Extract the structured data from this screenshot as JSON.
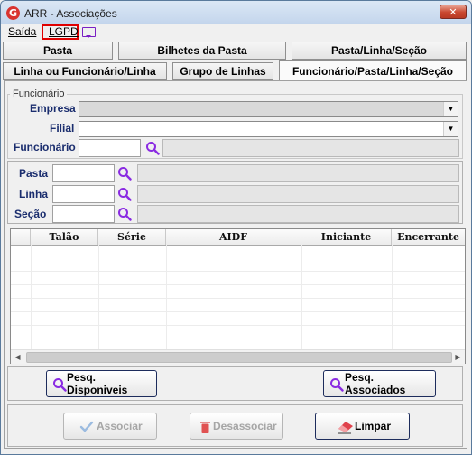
{
  "window": {
    "title": "ARR - Associações",
    "close_glyph": "✕",
    "app_icon": "G"
  },
  "menu": {
    "saida": "Saída",
    "lgpd": "LGPD"
  },
  "tabs_row1": [
    "Pasta",
    "Bilhetes da Pasta",
    "Pasta/Linha/Seção"
  ],
  "tabs_row2": [
    "Linha ou Funcionário/Linha",
    "Grupo de Linhas",
    "Funcionário/Pasta/Linha/Seção"
  ],
  "active_tab": "Funcionário/Pasta/Linha/Seção",
  "funcionario_group": {
    "title": "Funcionário",
    "empresa_label": "Empresa",
    "empresa_value": "",
    "filial_label": "Filial",
    "filial_value": "",
    "funcionario_label": "Funcionário",
    "funcionario_code": "",
    "funcionario_name": ""
  },
  "filters": {
    "pasta_label": "Pasta",
    "linha_label": "Linha",
    "secao_label": "Seção"
  },
  "table": {
    "columns": [
      "",
      "Talão",
      "Série",
      "AIDF",
      "Iniciante",
      "Encerrante"
    ],
    "rows": []
  },
  "buttons": {
    "pesq_disponiveis": "Pesq. Disponiveis",
    "pesq_associados": "Pesq. Associados",
    "associar": "Associar",
    "desassociar": "Desassociar",
    "limpar": "Limpar"
  },
  "colors": {
    "accent_purple": "#8a2be2",
    "close_red": "#c9472f",
    "label_blue": "#1a2d6e"
  }
}
